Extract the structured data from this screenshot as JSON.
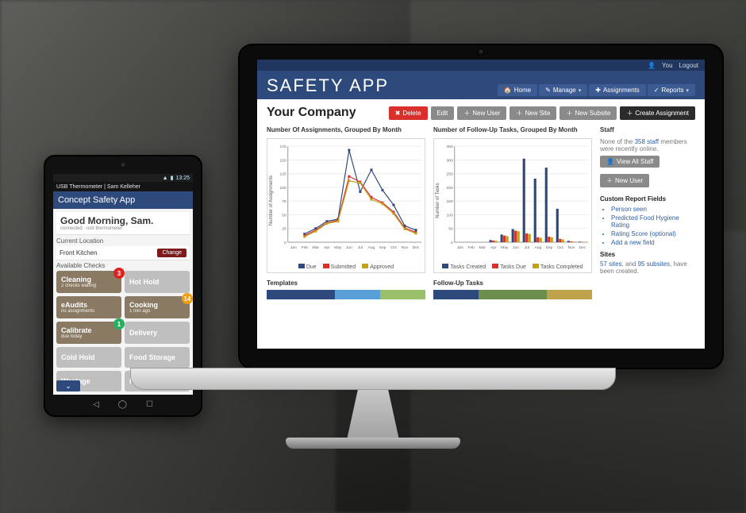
{
  "desktop": {
    "topstrip": {
      "user_icon": "👤",
      "user": "You",
      "logout": "Logout"
    },
    "title": "SAFETY APP",
    "nav": [
      {
        "icon": "🏠",
        "label": "Home",
        "caret": false
      },
      {
        "icon": "✎",
        "label": "Manage",
        "caret": true
      },
      {
        "icon": "✚",
        "label": "Assignments",
        "caret": false
      },
      {
        "icon": "✓",
        "label": "Reports",
        "caret": true
      }
    ],
    "company": "Your Company",
    "actions": {
      "delete": "Delete",
      "edit": "Edit",
      "new_user": "New User",
      "new_site": "New Site",
      "new_subsite": "New Subsite",
      "create_assignment": "Create Assignment"
    },
    "chart_left_title": "Number Of Assignments, Grouped By Month",
    "chart_right_title": "Number of Follow-Up Tasks, Grouped By Month",
    "templates_title": "Templates",
    "followup_title": "Follow-Up Tasks",
    "staff": {
      "title": "Staff",
      "text_a": "None of the ",
      "count": "358 staff",
      "text_b": " members were recently online.",
      "view_all": "View All Staff",
      "new_user": "New User"
    },
    "crf": {
      "title": "Custom Report Fields",
      "items": [
        "Person seen",
        "Predicted Food Hygiene Rating",
        "Rating Score (optional)",
        "Add a new field"
      ]
    },
    "sites": {
      "title": "Sites",
      "a": "57 sites",
      "mid": ", and ",
      "b": "95 subsites",
      "tail": ", have been created."
    }
  },
  "chart_data": [
    {
      "type": "line",
      "title": "Number Of Assignments, Grouped By Month",
      "xlabel": "",
      "ylabel": "Number of Assignments",
      "ylim": [
        0,
        175
      ],
      "categories": [
        "Jan",
        "Feb",
        "Mar",
        "Apr",
        "May",
        "Jun",
        "Jul",
        "Aug",
        "Sep",
        "Oct",
        "Nov",
        "Dec"
      ],
      "series": [
        {
          "name": "Due",
          "color": "#2e4a7d",
          "values": [
            null,
            15,
            25,
            38,
            42,
            168,
            92,
            132,
            95,
            68,
            30,
            22
          ]
        },
        {
          "name": "Submitted",
          "color": "#d9302c",
          "values": [
            null,
            12,
            22,
            35,
            40,
            120,
            110,
            82,
            72,
            55,
            26,
            18
          ]
        },
        {
          "name": "Approved",
          "color": "#c1a21e",
          "values": [
            null,
            10,
            20,
            34,
            38,
            112,
            108,
            78,
            70,
            52,
            24,
            16
          ]
        }
      ],
      "legend": [
        "Due",
        "Submitted",
        "Approved"
      ]
    },
    {
      "type": "bar",
      "title": "Number of Follow-Up Tasks, Grouped By Month",
      "xlabel": "",
      "ylabel": "Number of Tasks",
      "ylim": [
        0,
        350
      ],
      "categories": [
        "Jan",
        "Feb",
        "Mar",
        "Apr",
        "May",
        "Jun",
        "Jul",
        "Aug",
        "Sep",
        "Oct",
        "Nov",
        "Dec"
      ],
      "series": [
        {
          "name": "Tasks Created",
          "color": "#2e4a7d",
          "values": [
            0,
            0,
            0,
            8,
            28,
            48,
            305,
            232,
            272,
            122,
            5,
            2
          ]
        },
        {
          "name": "Tasks Due",
          "color": "#d9302c",
          "values": [
            0,
            0,
            0,
            6,
            24,
            42,
            32,
            18,
            20,
            12,
            3,
            1
          ]
        },
        {
          "name": "Tasks Completed",
          "color": "#c1a21e",
          "values": [
            0,
            0,
            0,
            5,
            22,
            40,
            30,
            16,
            18,
            10,
            2,
            1
          ]
        }
      ],
      "legend": [
        "Tasks Created",
        "Tasks Due",
        "Tasks Completed"
      ]
    }
  ],
  "tablet": {
    "status_time": "13:25",
    "crumb": "USB Thermometer | Sam Kelleher",
    "appbar": "Concept Safety App",
    "greeting": "Good Morning, Sam.",
    "greeting_sub": "connected · usb thermometer",
    "loc_label": "Current Location",
    "location": "Front Kitchen",
    "change": "Change",
    "avail_label": "Available Checks",
    "tiles": [
      {
        "label": "Cleaning",
        "sub": "2 checks waiting",
        "brown": true,
        "badge": {
          "n": "3",
          "c": "red"
        }
      },
      {
        "label": "Hot Hold",
        "sub": "",
        "brown": false
      },
      {
        "label": "eAudits",
        "sub": "no assignments",
        "brown": true
      },
      {
        "label": "Cooking",
        "sub": "1 min ago",
        "brown": true,
        "badge": {
          "n": "14",
          "c": "orange"
        }
      },
      {
        "label": "Calibrate",
        "sub": "due today",
        "brown": true,
        "badge": {
          "n": "1",
          "c": "green"
        }
      },
      {
        "label": "Delivery",
        "sub": "",
        "brown": false
      },
      {
        "label": "Cold Hold",
        "sub": "",
        "brown": false
      },
      {
        "label": "Food Storage",
        "sub": "",
        "brown": false
      },
      {
        "label": "Wastage",
        "sub": "",
        "brown": false
      },
      {
        "label": "Reheat",
        "sub": "",
        "brown": false
      }
    ]
  }
}
